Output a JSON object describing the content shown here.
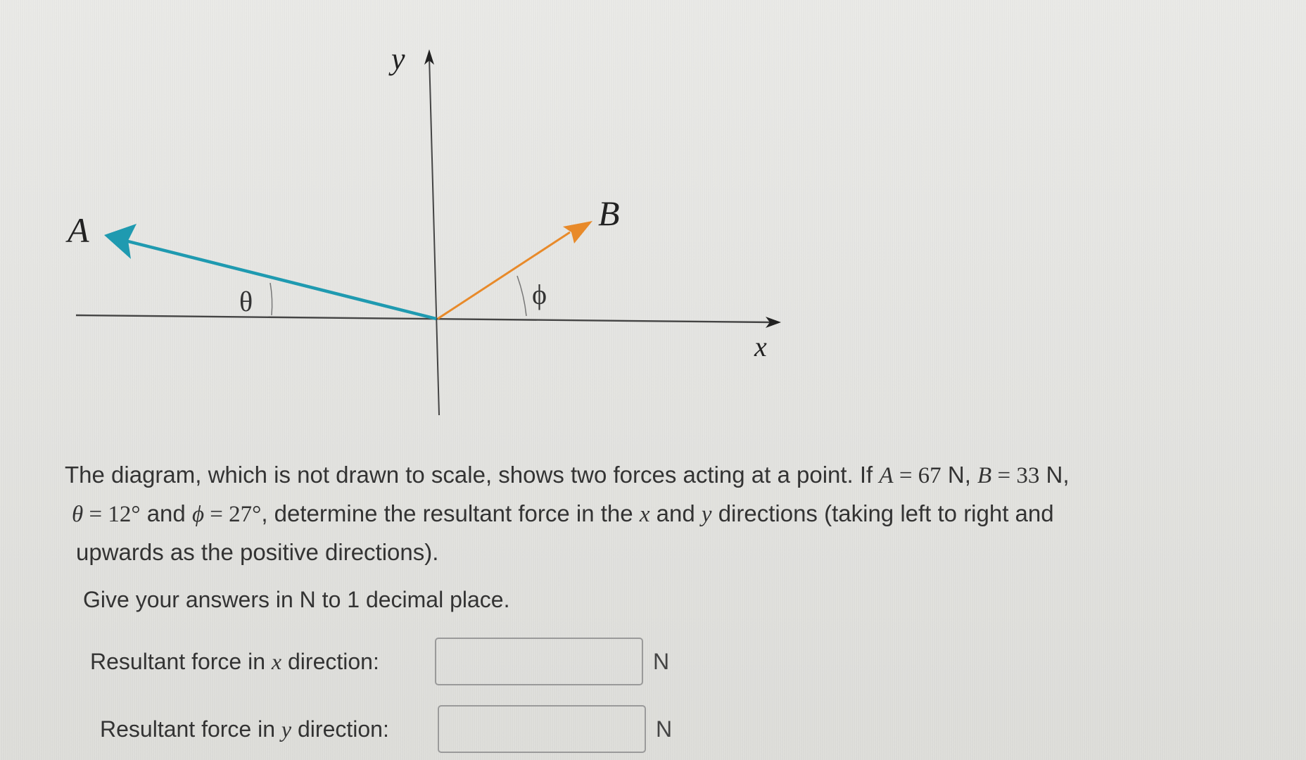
{
  "diagram": {
    "axis_labels": {
      "y": "y",
      "x": "x"
    },
    "forces": [
      {
        "label": "A",
        "color": "#1f9ab0",
        "direction": "up-left",
        "angle_symbol": "θ",
        "angle_reference": "negative x-axis"
      },
      {
        "label": "B",
        "color": "#e88a2a",
        "direction": "up-right",
        "angle_symbol": "ϕ",
        "angle_reference": "positive x-axis"
      }
    ],
    "angle_labels": {
      "theta": "θ",
      "phi": "ϕ"
    },
    "note": "not drawn to scale"
  },
  "question": {
    "line1_text": "The diagram, which is not drawn to scale, shows two forces acting at a point. If ",
    "A_symbol": "A",
    "A_eq": " = 67",
    "A_unit": " N, ",
    "B_symbol": "B",
    "B_eq": " = 33",
    "B_unit": " N,",
    "theta_symbol": "θ",
    "theta_value": " = 12°",
    "and_text": " and ",
    "phi_symbol": "ϕ",
    "phi_value": " = 27°",
    "line2_rest_a": ", determine the resultant force in the ",
    "x_symbol": "x",
    "line2_rest_b": " and ",
    "y_symbol": "y",
    "line2_rest_c": " directions (taking left to right and",
    "line3_text": "upwards as the positive directions)."
  },
  "values": {
    "A_N": 67,
    "B_N": 33,
    "theta_deg": 12,
    "phi_deg": 27
  },
  "instruction": "Give your answers in N to 1 decimal place.",
  "answers": [
    {
      "label_pre": "Resultant force in ",
      "symbol": "x",
      "label_post": " direction:",
      "value": "",
      "placeholder": "",
      "unit": "N"
    },
    {
      "label_pre": "Resultant force in ",
      "symbol": "y",
      "label_post": " direction:",
      "value": "",
      "placeholder": "",
      "unit": "N"
    }
  ]
}
